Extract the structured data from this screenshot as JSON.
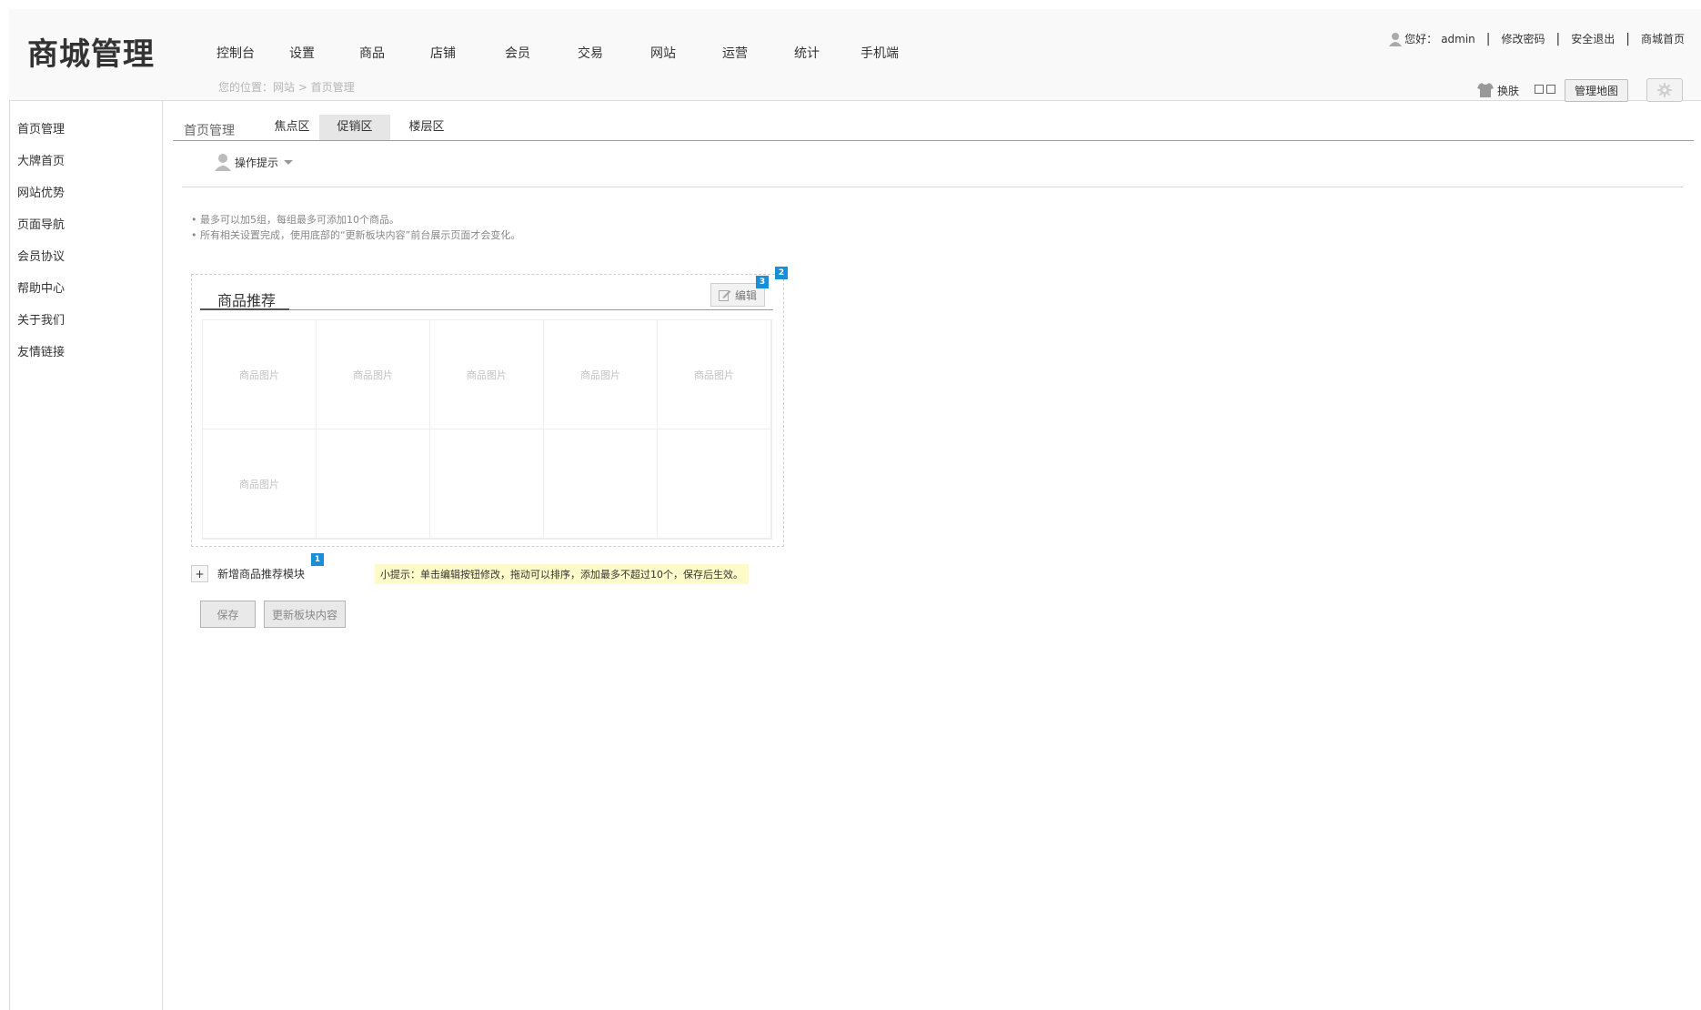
{
  "header": {
    "logo": "商城管理",
    "nav": [
      "控制台",
      "设置",
      "商品",
      "店铺",
      "会员",
      "交易",
      "网站",
      "运营",
      "统计",
      "手机端"
    ],
    "breadcrumb": "您的位置：网站 > 首页管理",
    "user": {
      "greeting": "您好：",
      "name": "admin",
      "links": [
        "修改密码",
        "安全退出",
        "商城首页"
      ]
    },
    "tools": {
      "skin_label": "换肤",
      "map_button": "管理地图"
    }
  },
  "sidebar": {
    "items": [
      "首页管理",
      "大牌首页",
      "网站优势",
      "页面导航",
      "会员协议",
      "帮助中心",
      "关于我们",
      "友情链接"
    ]
  },
  "main": {
    "section_title": "首页管理",
    "tabs": [
      {
        "label": "焦点区",
        "active": false
      },
      {
        "label": "促销区",
        "active": true
      },
      {
        "label": "楼层区",
        "active": false
      }
    ],
    "tips_label": "操作提示",
    "notes": [
      "• 最多可以加5组，每组最多可添加10个商品。",
      "• 所有相关设置完成，使用底部的“更新板块内容”前台展示页面才会变化。"
    ],
    "module": {
      "title": "商品推荐",
      "edit_label": "编辑",
      "badges": [
        "1",
        "2",
        "3"
      ],
      "placeholder": "商品图片",
      "filled_cells": 6,
      "total_cells": 10
    },
    "add_module_label": "新增商品推荐模块",
    "add_symbol": "+",
    "hint": "小提示：单击编辑按钮修改，拖动可以排序，添加最多不超过10个，保存后生效。",
    "save_label": "保存",
    "update_label": "更新板块内容"
  }
}
